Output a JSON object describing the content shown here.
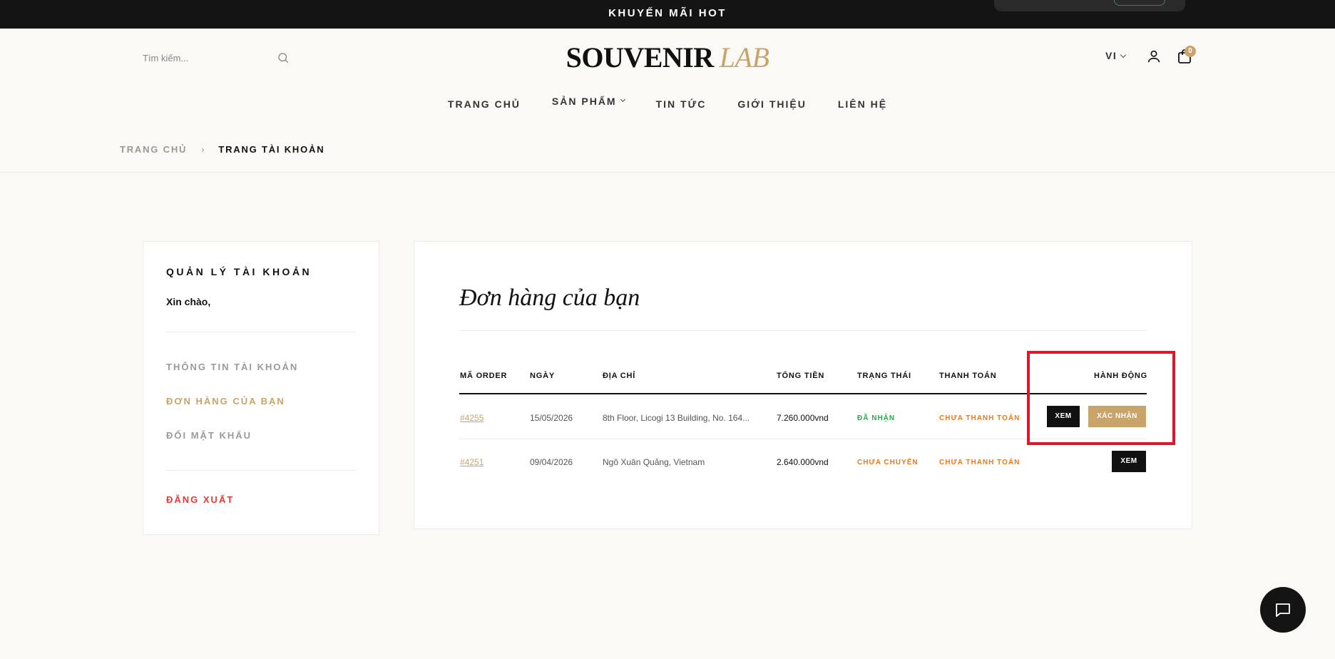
{
  "topbar": {
    "promo": "KHUYẾN MÃI HOT"
  },
  "header": {
    "search": {
      "placeholder": "Tìm kiếm..."
    },
    "logo": {
      "part1": "SOUVENIR",
      "part2": "LAB"
    },
    "lang": "VI",
    "cart_count": "0"
  },
  "nav": {
    "items": [
      {
        "label": "TRANG CHỦ"
      },
      {
        "label": "SẢN PHẨM"
      },
      {
        "label": "TIN TỨC"
      },
      {
        "label": "GIỚI THIỆU"
      },
      {
        "label": "LIÊN HỆ"
      }
    ]
  },
  "breadcrumb": {
    "home": "TRANG CHỦ",
    "sep": "›",
    "current": "TRANG TÀI KHOẢN"
  },
  "sidebar": {
    "title": "QUẢN LÝ TÀI KHOẢN",
    "greeting": "Xin chào,",
    "items": [
      {
        "label": "THÔNG TIN TÀI KHOẢN",
        "color": "#9a9a9a"
      },
      {
        "label": "ĐƠN HÀNG CỦA BẠN",
        "color": "#c8a46a"
      },
      {
        "label": "ĐỔI MẬT KHẨU",
        "color": "#9a9a9a"
      }
    ],
    "logout": {
      "label": "ĐĂNG XUẤT",
      "color": "#e53935"
    }
  },
  "orders": {
    "heading": "Đơn hàng của bạn",
    "columns": [
      "MÃ ORDER",
      "NGÀY",
      "ĐỊA CHỈ",
      "TỔNG TIỀN",
      "TRẠNG THÁI",
      "THANH TOÁN",
      "HÀNH ĐỘNG"
    ],
    "rows": [
      {
        "id": "#4255",
        "date": "15/05/2026",
        "address": "8th Floor, Licogi 13 Building, No. 164...",
        "total": "7.260.000vnd",
        "status": "ĐÃ NHẬN",
        "payment": "CHƯA THANH TOÁN",
        "actions": [
          "XEM",
          "XÁC NHẬN"
        ]
      },
      {
        "id": "#4251",
        "date": "09/04/2026",
        "address": "Ngô Xuân Quảng, Vietnam",
        "total": "2.640.000vnd",
        "status": "CHƯA CHUYỂN",
        "payment": "CHƯA THANH TOÁN",
        "actions": [
          "XEM"
        ]
      }
    ]
  },
  "colors": {
    "accent": "#c8a46a",
    "dark": "#141414",
    "highlight": "#e0162b"
  }
}
